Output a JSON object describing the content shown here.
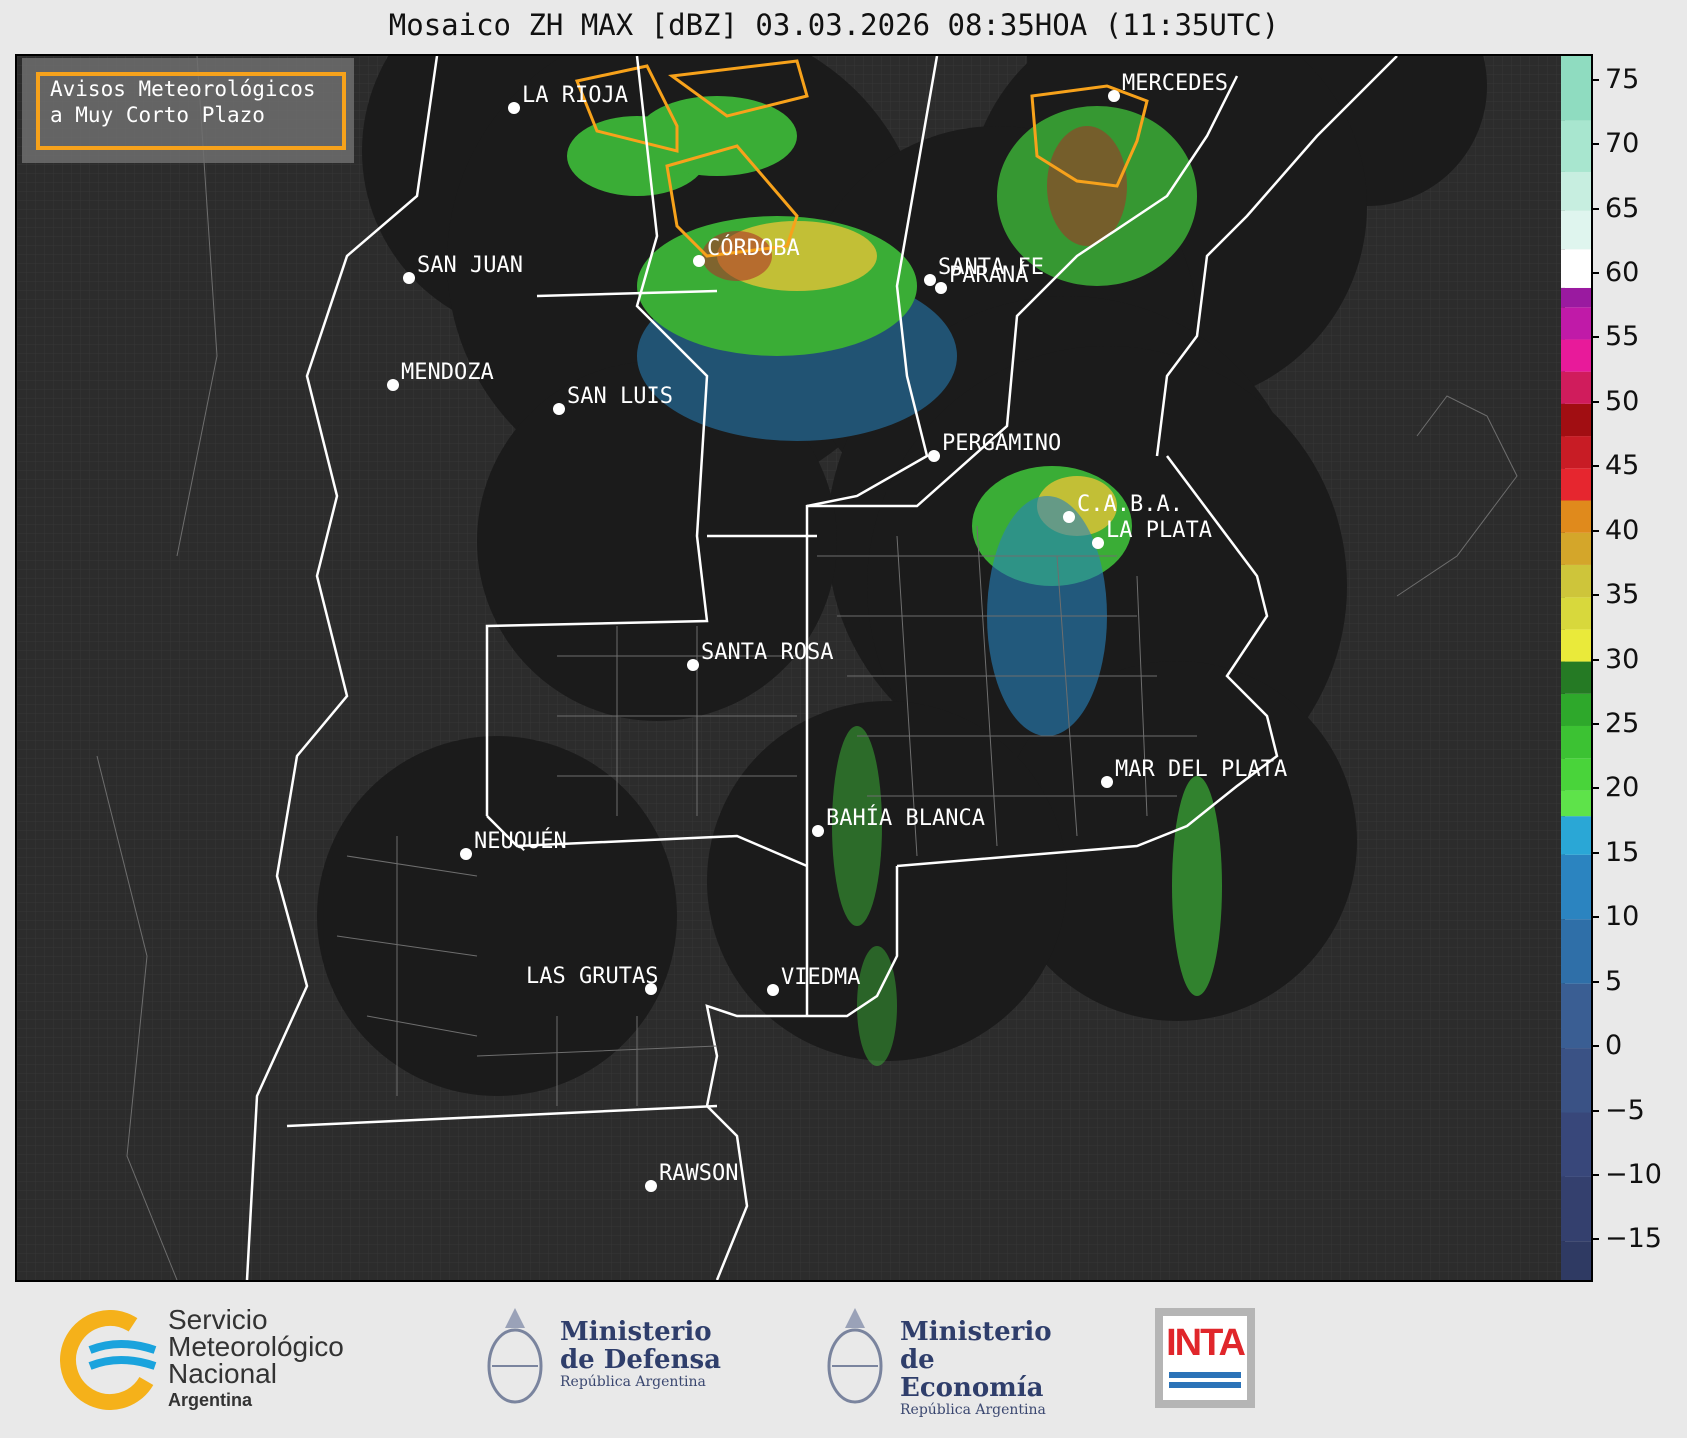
{
  "title": "Mosaico ZH MAX [dBZ] 03.03.2026 08:35HOA (11:35UTC)",
  "legend": {
    "line1": "Avisos Meteorológicos",
    "line2": "a Muy Corto Plazo",
    "border_color": "#f7a21b"
  },
  "cities": [
    {
      "name": "LA RIOJA"
    },
    {
      "name": "MERCEDES"
    },
    {
      "name": "CÓRDOBA"
    },
    {
      "name": "SAN JUAN"
    },
    {
      "name": "SANTA FE"
    },
    {
      "name": "PARANÁ"
    },
    {
      "name": "MENDOZA"
    },
    {
      "name": "SAN LUIS"
    },
    {
      "name": "PERGAMINO"
    },
    {
      "name": "C.A.B.A."
    },
    {
      "name": "LA PLATA"
    },
    {
      "name": "SANTA ROSA"
    },
    {
      "name": "MAR DEL PLATA"
    },
    {
      "name": "BAHÍA BLANCA"
    },
    {
      "name": "NEUQUÉN"
    },
    {
      "name": "LAS GRUTAS"
    },
    {
      "name": "VIEDMA"
    },
    {
      "name": "RAWSON"
    }
  ],
  "colorbar": {
    "unit": "dBZ",
    "min": -18,
    "max": 77,
    "ticks": [
      "75",
      "70",
      "65",
      "60",
      "55",
      "50",
      "45",
      "40",
      "35",
      "30",
      "25",
      "20",
      "15",
      "10",
      "5",
      "0",
      "−5",
      "−10",
      "−15"
    ]
  },
  "footer": {
    "smn_line1": "Servicio",
    "smn_line2": "Meteorológico",
    "smn_line3": "Nacional",
    "smn_line4": "Argentina",
    "defensa_line1": "Ministerio",
    "defensa_line2": "de Defensa",
    "defensa_sub": "República Argentina",
    "economia_line1": "Ministerio",
    "economia_line2": "de Economía",
    "economia_sub": "República Argentina",
    "inta": "INTA"
  },
  "colors": {
    "background": "#2c2c2c",
    "radar_coverage": "#1b1b1b",
    "boundary": "#ffffff",
    "warning": "#f7a21b"
  }
}
